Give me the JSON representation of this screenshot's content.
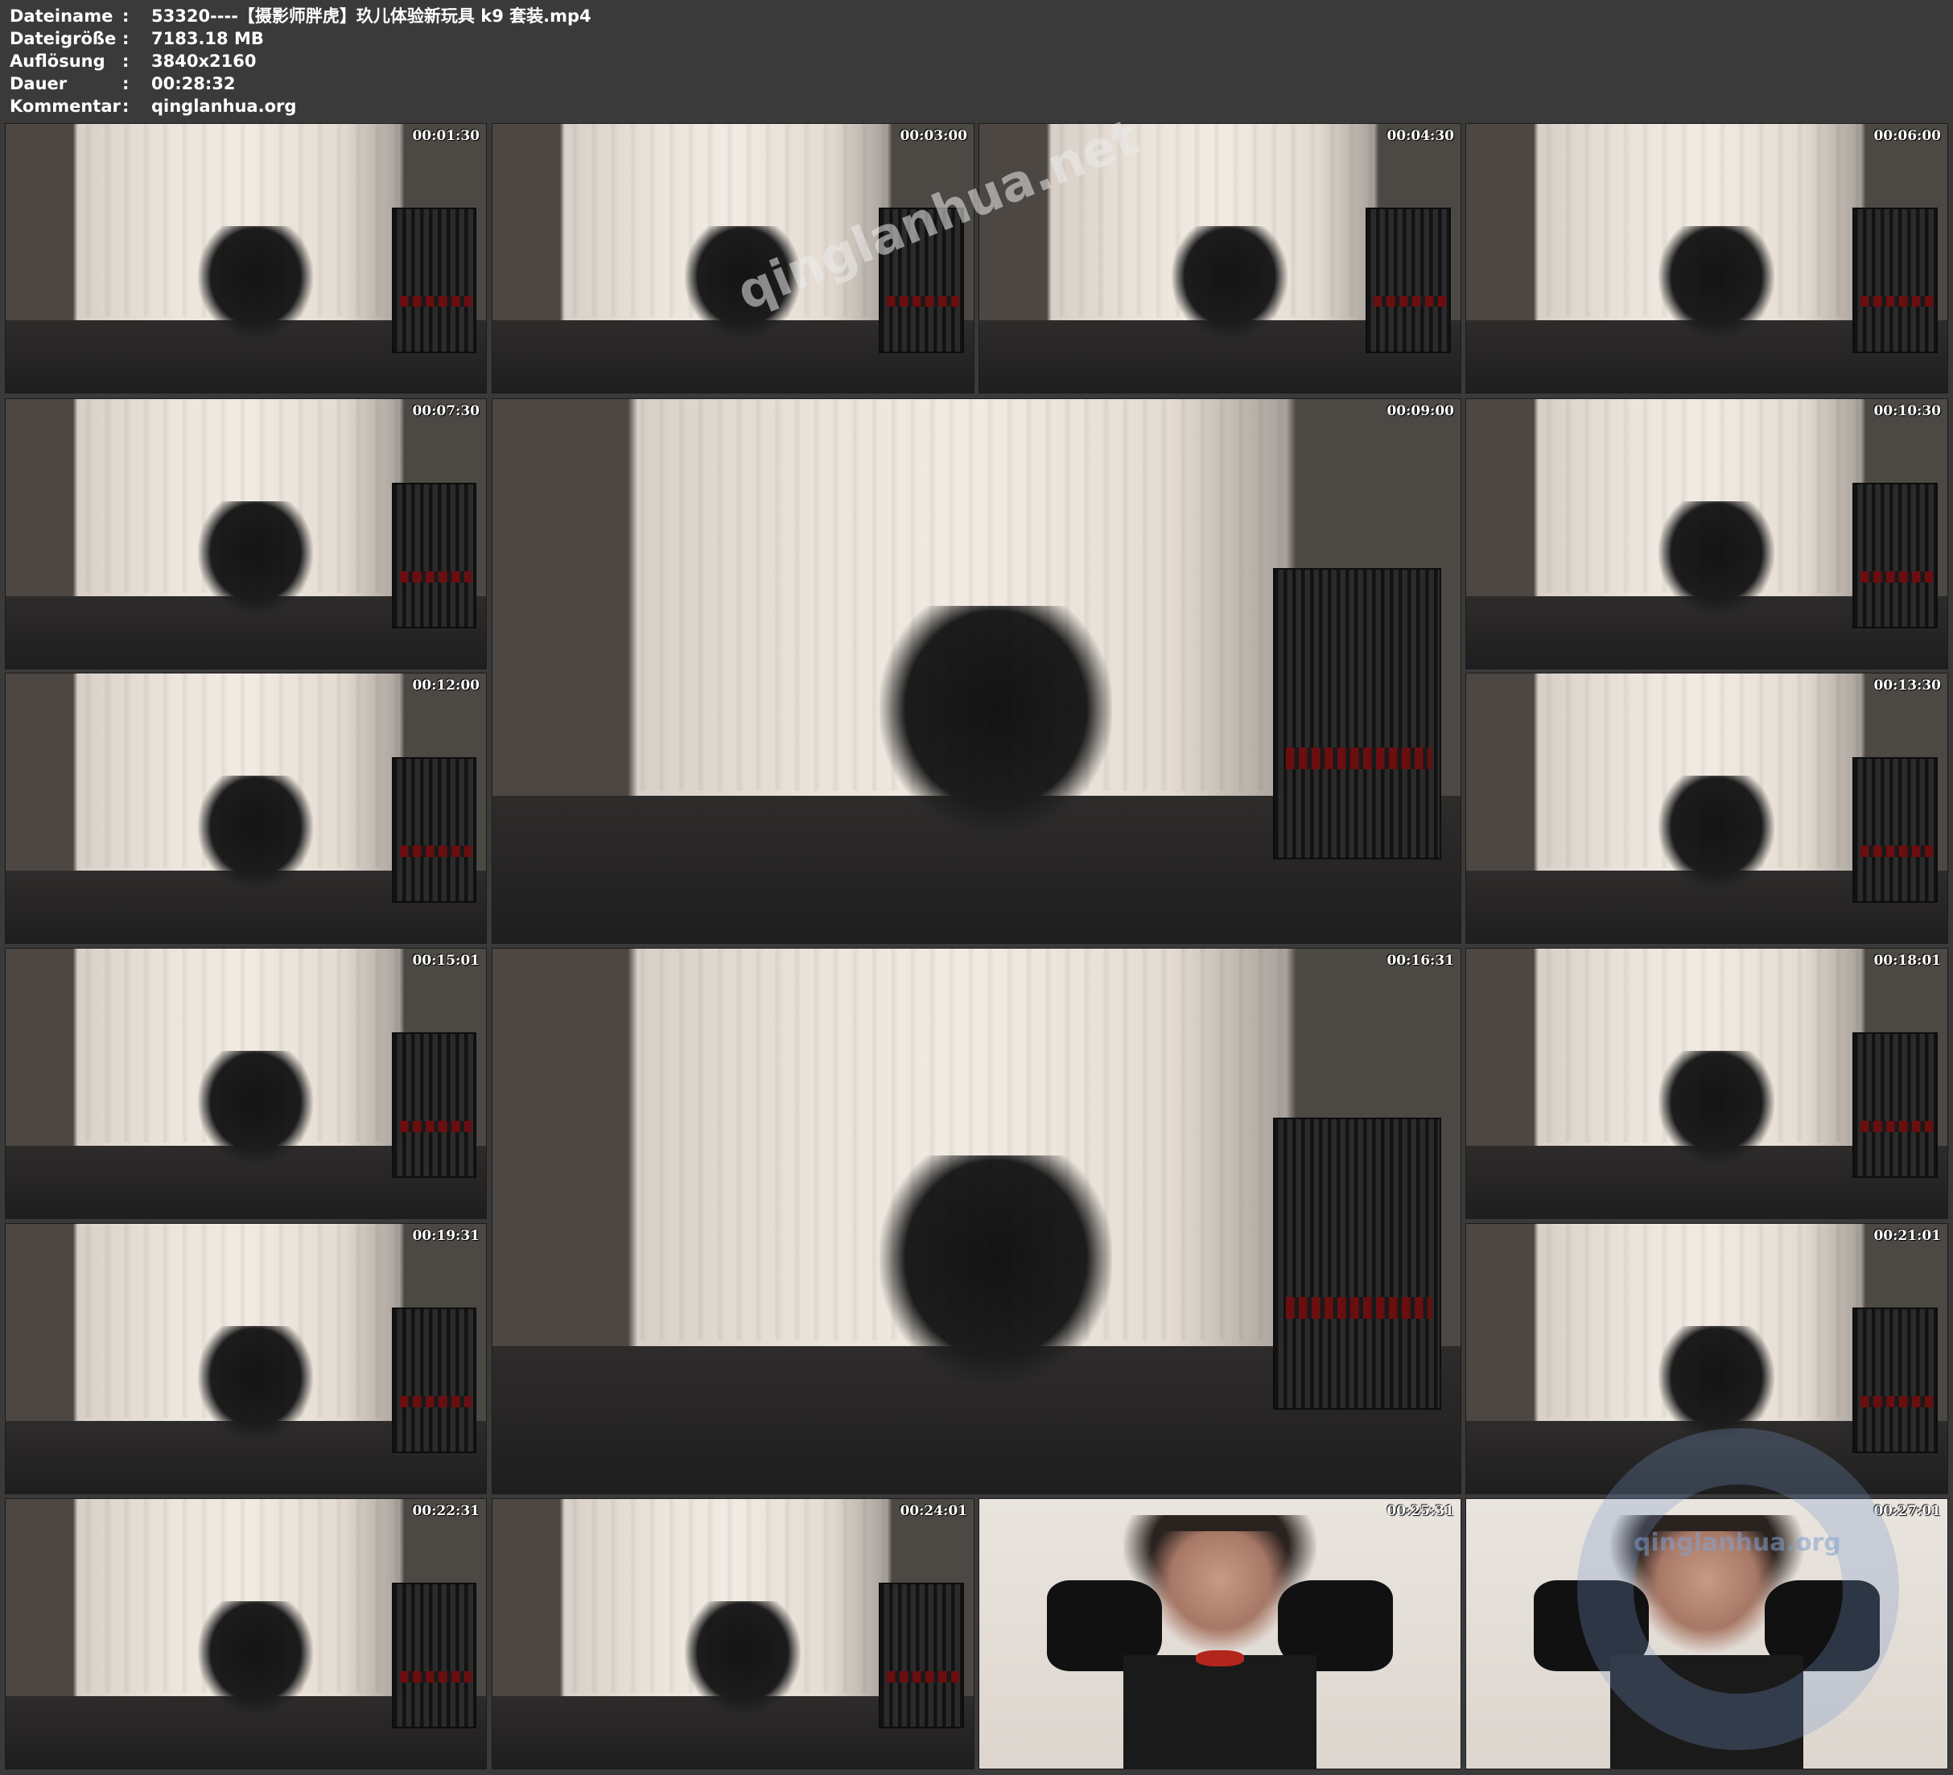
{
  "header": {
    "rows": [
      {
        "label": "Dateiname",
        "value": "53320----【摄影师胖虎】玖儿体验新玩具 k9 套装.mp4"
      },
      {
        "label": "Dateigröße",
        "value": "7183.18 MB"
      },
      {
        "label": "Auflösung",
        "value": "3840x2160"
      },
      {
        "label": "Dauer",
        "value": "00:28:32"
      },
      {
        "label": "Kommentar",
        "value": "qinglanhua.org"
      }
    ],
    "separator": ":"
  },
  "thumbnails": [
    {
      "timestamp": "00:01:30"
    },
    {
      "timestamp": "00:03:00"
    },
    {
      "timestamp": "00:04:30"
    },
    {
      "timestamp": "00:06:00"
    },
    {
      "timestamp": "00:07:30"
    },
    {
      "timestamp": "00:09:00"
    },
    {
      "timestamp": "00:10:30"
    },
    {
      "timestamp": "00:12:00"
    },
    {
      "timestamp": "00:13:30"
    },
    {
      "timestamp": "00:15:01"
    },
    {
      "timestamp": "00:16:31"
    },
    {
      "timestamp": "00:18:01"
    },
    {
      "timestamp": "00:19:31"
    },
    {
      "timestamp": "00:21:01"
    },
    {
      "timestamp": "00:22:31"
    },
    {
      "timestamp": "00:24:01"
    },
    {
      "timestamp": "00:25:31"
    },
    {
      "timestamp": "00:27:01"
    }
  ],
  "watermarks": {
    "diagonal": "qinglanhua.net",
    "ring": "qinglanhua.org"
  }
}
